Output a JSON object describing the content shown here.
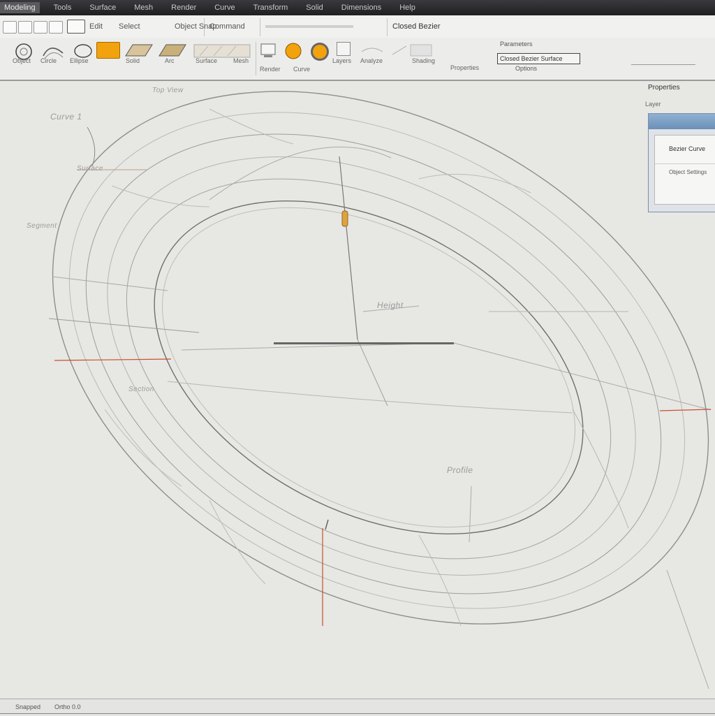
{
  "app": {
    "menu": [
      "Modeling",
      "Tools",
      "Surface",
      "Mesh",
      "Render",
      "Curve",
      "Transform",
      "Solid",
      "Dimensions",
      "Help"
    ]
  },
  "toolbar": {
    "row1_labels": [
      "Edit",
      "Select",
      "Object Snap",
      "Command"
    ],
    "command_value": "Closed Bezier",
    "tool_labels": [
      "Object",
      "Circle",
      "Ellipse",
      "Solid",
      "Arc",
      "Surface",
      "Mesh",
      "Render",
      "Curve",
      "Layers",
      "Analyze",
      "Shading",
      "Properties"
    ],
    "options_label": "Parameters",
    "options_dropdown_value": "Closed Bezier Surface",
    "options_sub_value": "Options"
  },
  "panel": {
    "title": "Properties",
    "subtitle": "Layer",
    "input_value": "Bezier Curve",
    "line2": "Object Settings"
  },
  "canvas": {
    "labels": [
      "Top View",
      "Curve 1",
      "Surface",
      "Segment",
      "Height",
      "Profile",
      "Section"
    ]
  },
  "status": {
    "left": "Snapped",
    "coords": "Ortho 0.0"
  },
  "colors": {
    "accent_orange": "#f2a20c",
    "wire_gray": "#777777",
    "wire_light": "#b9b9b9",
    "guide_red": "#c8502c",
    "panel_blue": "#6b8fb7"
  },
  "icons": [
    "new-file-icon",
    "open-icon",
    "save-icon",
    "circle-icon",
    "curve-icon",
    "solid-icon",
    "orange-sphere-icon",
    "mesh-icon"
  ]
}
